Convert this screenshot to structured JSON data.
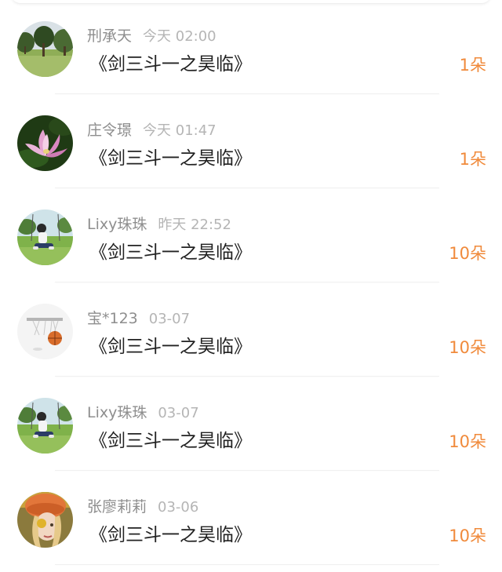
{
  "gifts": [
    {
      "user": "刑承天",
      "time": "今天 02:00",
      "title": "《剑三斗一之昊临》",
      "amount": "1朵",
      "avatar": "tree-photo-avatar"
    },
    {
      "user": "庄令璟",
      "time": "今天 01:47",
      "title": "《剑三斗一之昊临》",
      "amount": "1朵",
      "avatar": "lotus-flower-avatar"
    },
    {
      "user": "Lixy珠珠",
      "time": "昨天 22:52",
      "title": "《剑三斗一之昊临》",
      "amount": "10朵",
      "avatar": "person-on-swing-avatar"
    },
    {
      "user": "宝*123",
      "time": "03-07",
      "title": "《剑三斗一之昊临》",
      "amount": "10朵",
      "avatar": "basketball-hoop-avatar"
    },
    {
      "user": "Lixy珠珠",
      "time": "03-07",
      "title": "《剑三斗一之昊临》",
      "amount": "10朵",
      "avatar": "person-on-swing-avatar"
    },
    {
      "user": "张廖莉莉",
      "time": "03-06",
      "title": "《剑三斗一之昊临》",
      "amount": "10朵",
      "avatar": "orange-hat-girl-avatar"
    }
  ],
  "colors": {
    "amount": "#f08a3b",
    "username": "#8e8e8e",
    "time": "#b5b5b5",
    "title": "#222222"
  }
}
